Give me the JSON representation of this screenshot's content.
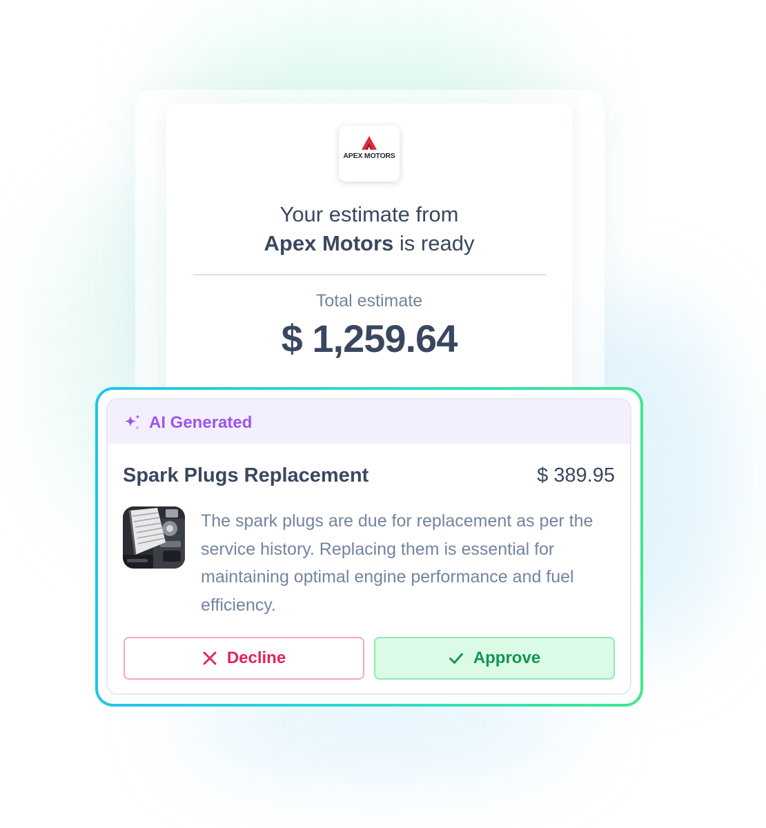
{
  "brand": {
    "logo_text": "APEX MOTORS",
    "logo_icon": "apex-a-icon",
    "accent_color": "#e0283a"
  },
  "estimate": {
    "headline_line1": "Your estimate from",
    "headline_name": "Apex Motors",
    "headline_suffix": " is ready",
    "total_label": "Total estimate",
    "total_value": "$ 1,259.64"
  },
  "ai_card": {
    "badge_icon": "sparkle-icon",
    "badge_label": "AI Generated",
    "badge_color": "#9a55f0",
    "item": {
      "title": "Spark Plugs Replacement",
      "price": "$ 389.95",
      "thumbnail_icon": "engine-photo",
      "description": "The spark plugs are due for replacement as per the service history. Replacing them is essential for maintaining optimal engine performance and fuel efficiency."
    },
    "actions": {
      "decline_label": "Decline",
      "decline_icon": "close-icon",
      "decline_color": "#e0245e",
      "approve_label": "Approve",
      "approve_icon": "check-icon",
      "approve_color": "#0f9650"
    }
  }
}
